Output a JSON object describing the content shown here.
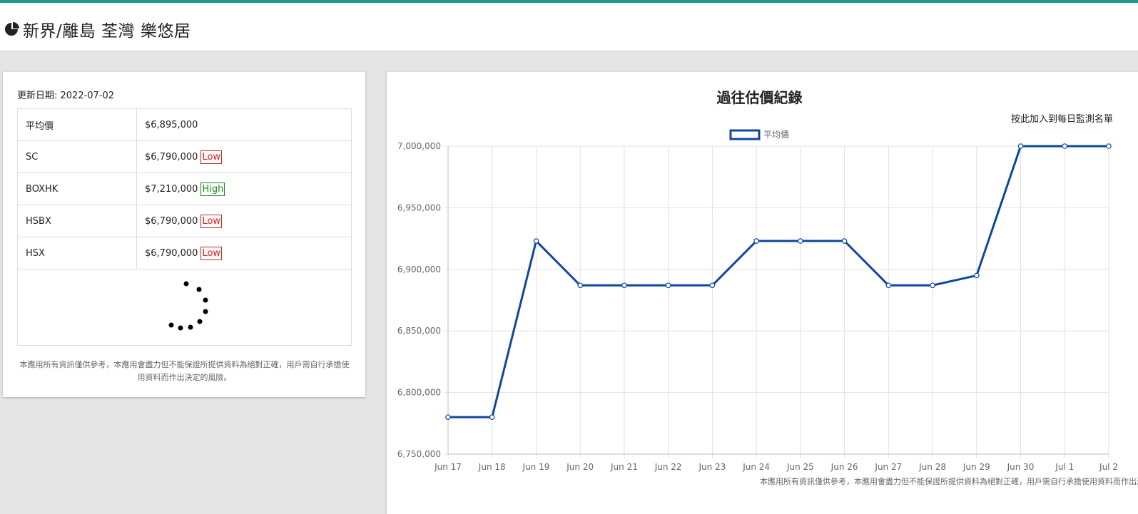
{
  "header": {
    "title": "新界/離島 荃灣 樂悠居",
    "icon": "pie-chart-icon",
    "accent_color": "#1a9c8a"
  },
  "summary": {
    "update_label": "更新日期: 2022-07-02",
    "rows": [
      {
        "label": "平均價",
        "value": "$6,895,000",
        "badge": ""
      },
      {
        "label": "SC",
        "value": "$6,790,000",
        "badge": "Low"
      },
      {
        "label": "BOXHK",
        "value": "$7,210,000",
        "badge": "High"
      },
      {
        "label": "HSBX",
        "value": "$6,790,000",
        "badge": "Low"
      },
      {
        "label": "HSX",
        "value": "$6,790,000",
        "badge": "Low"
      }
    ],
    "disclaimer": "本應用所有資訊僅供參考，本應用會盡力但不能保證所提供資料為絕對正確，用戶需自行承擔使用資料而作出決定的風險。"
  },
  "chart_panel": {
    "watch_link": "按此加入到每日監測名單",
    "disclaimer": "本應用所有資訊僅供參考，本應用會盡力但不能保證所提供資料為絕對正確，用戶需自行承擔使用資料而作出決定的風險。"
  },
  "chart_data": {
    "type": "line",
    "title": "過往估價紀錄",
    "xlabel": "",
    "ylabel": "",
    "categories": [
      "Jun 17",
      "Jun 18",
      "Jun 19",
      "Jun 20",
      "Jun 21",
      "Jun 22",
      "Jun 23",
      "Jun 24",
      "Jun 25",
      "Jun 26",
      "Jun 27",
      "Jun 28",
      "Jun 29",
      "Jun 30",
      "Jul 1",
      "Jul 2"
    ],
    "series": [
      {
        "name": "平均價",
        "color": "#0d47a1",
        "values": [
          6780000,
          6780000,
          6923000,
          6887000,
          6887000,
          6887000,
          6887000,
          6923000,
          6923000,
          6923000,
          6887000,
          6887000,
          6895000,
          7000000,
          7000000,
          7000000
        ]
      }
    ],
    "ylim": [
      6750000,
      7000000
    ],
    "yticks": [
      6750000,
      6800000,
      6850000,
      6900000,
      6950000,
      7000000
    ],
    "ytick_labels": [
      "6,750,000",
      "6,800,000",
      "6,850,000",
      "6,900,000",
      "6,950,000",
      "7,000,000"
    ],
    "grid": true,
    "legend": "top-center"
  }
}
